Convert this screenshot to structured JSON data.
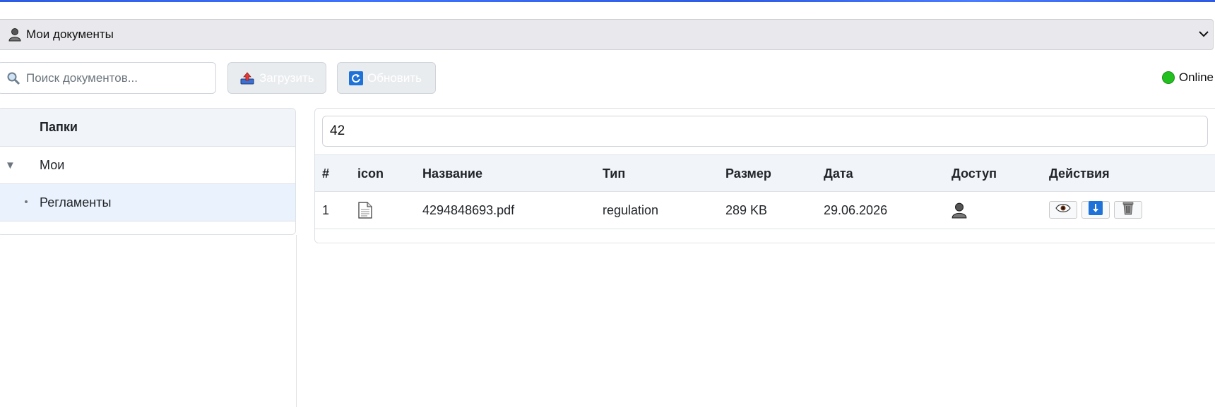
{
  "header": {
    "title": "Мои документы"
  },
  "search": {
    "placeholder": "Поиск документов..."
  },
  "toolbar": {
    "upload_label": "Загрузить",
    "refresh_label": "Обновить"
  },
  "status": {
    "label": "Online",
    "color": "#22c01e"
  },
  "sidebar": {
    "header": "Папки",
    "items": [
      {
        "label": "Мои",
        "expanded": true
      },
      {
        "label": "Регламенты",
        "selected": true
      }
    ]
  },
  "filter": {
    "value": "42"
  },
  "table": {
    "columns": [
      "#",
      "icon",
      "Название",
      "Тип",
      "Размер",
      "Дата",
      "Доступ",
      "Действия"
    ],
    "rows": [
      {
        "num": "1",
        "icon": "document-icon",
        "name": "4294848693.pdf",
        "type": "regulation",
        "size": "289 KB",
        "date": "29.06.2026",
        "access": "user-icon",
        "actions": [
          "view-eye-icon",
          "download-icon",
          "trash-icon"
        ]
      }
    ]
  }
}
